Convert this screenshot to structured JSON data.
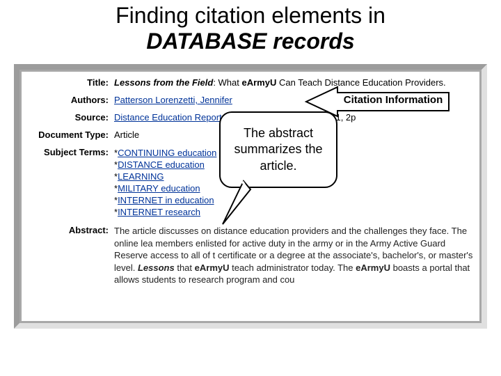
{
  "heading_line1": "Finding citation elements in",
  "heading_line2_em": "DATABASE records",
  "record": {
    "labels": {
      "title": "Title:",
      "authors": "Authors:",
      "source": "Source:",
      "doctype": "Document Type:",
      "subject": "Subject Terms:",
      "abstract": "Abstract:"
    },
    "title_italic": "Lessons from the Field",
    "title_sep": ": What ",
    "title_bold": "eArmyU",
    "title_rest": " Can Teach Distance Education Providers.",
    "author_link": "Patterson Lorenzetti, Jennifer",
    "source_link": "Distance Education Report",
    "source_rest": "; 6/1/2004, Vol. 8 Issue 11, p1, 2p",
    "doctype": "Article",
    "subjects": [
      "CONTINUING education",
      "DISTANCE education",
      "LEARNING",
      "MILITARY education",
      "INTERNET in education",
      "INTERNET research"
    ],
    "abstract_pre": "The article discusses on distance education providers and the challenges they face. The online lea members enlisted for active duty in the army or in the Army Active Guard Reserve access to all of t certificate or a degree at the associate's, bachelor's, or master's level. ",
    "abstract_lessons_italic": "Lessons",
    "abstract_mid": " that ",
    "abstract_bold1": "eArmyU",
    "abstract_teach": " teach administrator today. The ",
    "abstract_bold2": "eArmyU",
    "abstract_end": " boasts a portal that allows students to research program and cou"
  },
  "callout_bubble": "The abstract summarizes the article.",
  "callout_arrow": "Citation Information"
}
